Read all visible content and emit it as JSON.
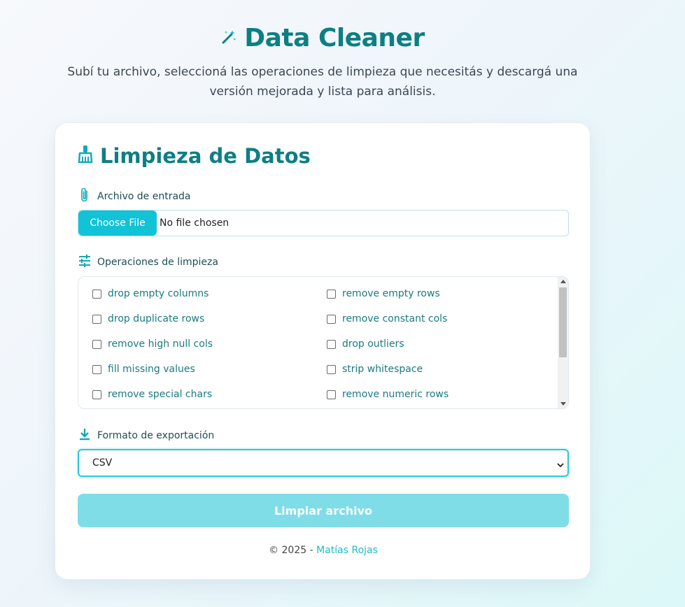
{
  "header": {
    "title": "Data Cleaner",
    "subtitle": "Subí tu archivo, seleccioná las operaciones de limpieza que necesitás y descargá una versión mejorada y lista para análisis.",
    "icon": "magic-wand-icon"
  },
  "card": {
    "title": "Limpieza de Datos",
    "icon": "broom-icon",
    "file": {
      "label": "Archivo de entrada",
      "icon": "paperclip-icon",
      "button_label": "Choose File",
      "status": "No file chosen"
    },
    "operations": {
      "label": "Operaciones de limpieza",
      "icon": "sliders-icon",
      "items": [
        {
          "label": "drop empty columns",
          "checked": false
        },
        {
          "label": "remove empty rows",
          "checked": false
        },
        {
          "label": "drop duplicate rows",
          "checked": false
        },
        {
          "label": "remove constant cols",
          "checked": false
        },
        {
          "label": "remove high null cols",
          "checked": false
        },
        {
          "label": "drop outliers",
          "checked": false
        },
        {
          "label": "fill missing values",
          "checked": false
        },
        {
          "label": "strip whitespace",
          "checked": false
        },
        {
          "label": "remove special chars",
          "checked": false
        },
        {
          "label": "remove numeric rows",
          "checked": false
        }
      ]
    },
    "export": {
      "label": "Formato de exportación",
      "icon": "download-icon",
      "selected": "CSV"
    },
    "submit_label": "Limpiar archivo"
  },
  "footer": {
    "prefix": "© 2025 - ",
    "author": "Matías Rojas"
  },
  "colors": {
    "primary": "#0d7f82",
    "accent": "#12c2d6",
    "button_disabled": "#7fdde8"
  }
}
